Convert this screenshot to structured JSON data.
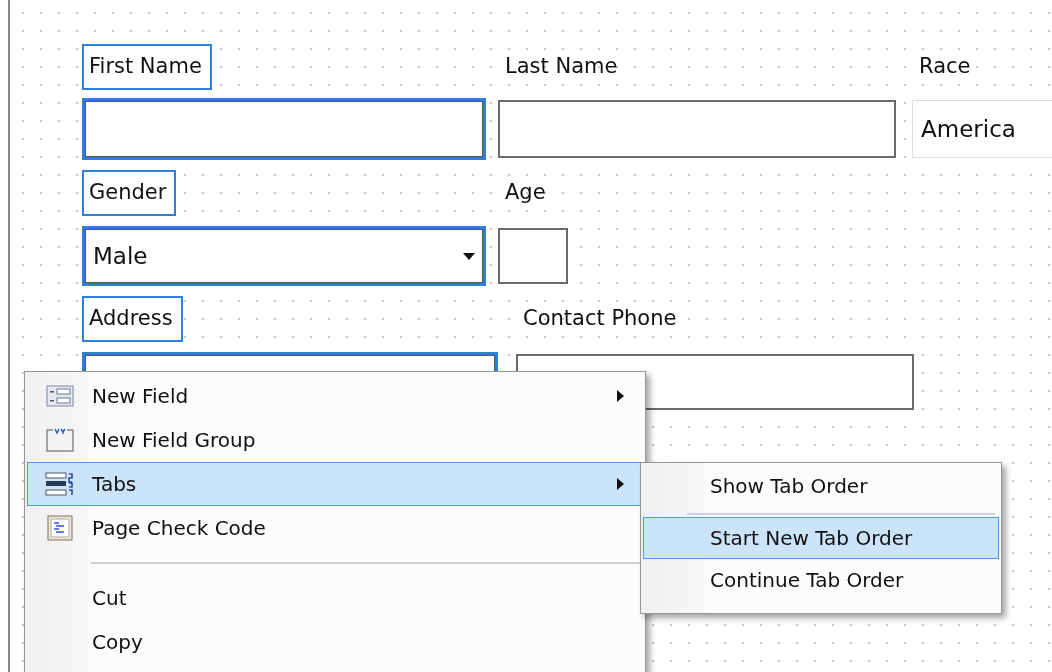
{
  "form": {
    "fields": [
      {
        "label": "First Name",
        "kind": "text",
        "selected": true
      },
      {
        "label": "Last Name",
        "kind": "text",
        "selected": false
      },
      {
        "label": "Race",
        "kind": "dropdown",
        "value": "America",
        "selected": false
      },
      {
        "label": "Gender",
        "kind": "dropdown",
        "value": "Male",
        "selected": true
      },
      {
        "label": "Age",
        "kind": "text",
        "selected": false
      },
      {
        "label": "Address",
        "kind": "text",
        "selected": true
      },
      {
        "label": "Contact Phone",
        "kind": "text",
        "selected": false
      }
    ]
  },
  "context_menu": {
    "items": [
      {
        "kind": "item",
        "label": "New Field",
        "submenu": true,
        "selected": false
      },
      {
        "kind": "item",
        "label": "New Field Group",
        "submenu": false,
        "selected": false
      },
      {
        "kind": "item",
        "label": "Tabs",
        "submenu": true,
        "selected": true
      },
      {
        "kind": "item",
        "label": "Page Check Code",
        "submenu": false,
        "selected": false
      },
      {
        "kind": "separator"
      },
      {
        "kind": "item",
        "label": "Cut",
        "submenu": false,
        "selected": false
      },
      {
        "kind": "item",
        "label": "Copy",
        "submenu": false,
        "selected": false
      }
    ]
  },
  "submenu": {
    "items": [
      {
        "kind": "item",
        "label": "Show Tab Order",
        "selected": false
      },
      {
        "kind": "separator"
      },
      {
        "kind": "item",
        "label": "Start New Tab Order",
        "selected": true
      },
      {
        "kind": "item",
        "label": "Continue Tab Order",
        "selected": false
      }
    ]
  }
}
